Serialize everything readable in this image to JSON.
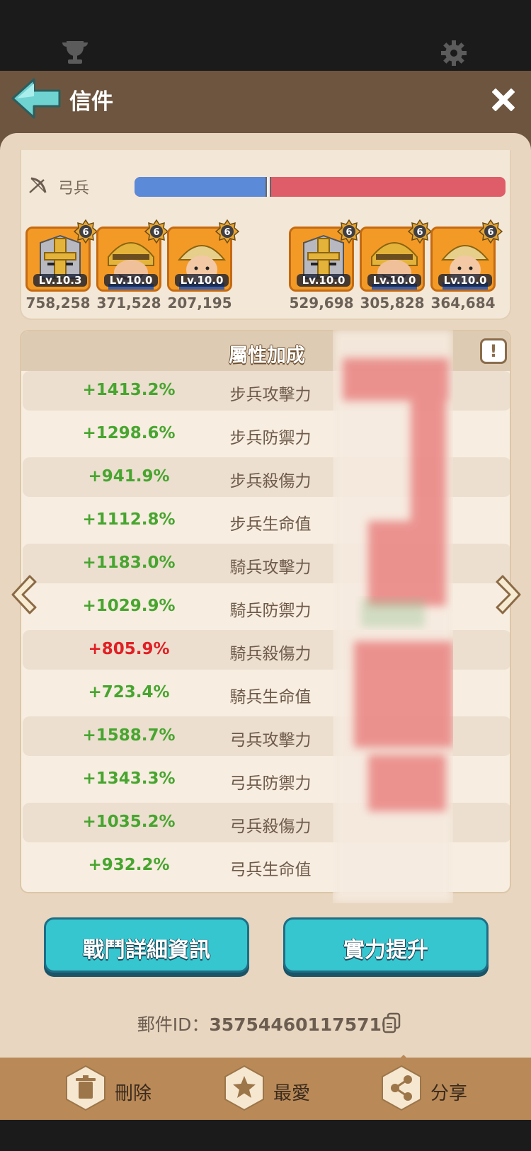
{
  "header": {
    "title": "信件"
  },
  "battle": {
    "troop_label": "弓兵",
    "balance_blue_fraction": 0.36,
    "left_heroes": [
      {
        "level": "Lv.10.3",
        "power": "758,258",
        "stars": "6"
      },
      {
        "level": "Lv.10.0",
        "power": "371,528",
        "stars": "6"
      },
      {
        "level": "Lv.10.0",
        "power": "207,195",
        "stars": "6"
      }
    ],
    "right_heroes": [
      {
        "level": "Lv.10.0",
        "power": "529,698",
        "stars": "6"
      },
      {
        "level": "Lv.10.0",
        "power": "305,828",
        "stars": "6"
      },
      {
        "level": "Lv.10.0",
        "power": "364,684",
        "stars": "6"
      }
    ]
  },
  "stats": {
    "title": "屬性加成",
    "info_label": "!",
    "rows": [
      {
        "value": "+1413.2%",
        "name": "步兵攻擊力"
      },
      {
        "value": "+1298.6%",
        "name": "步兵防禦力"
      },
      {
        "value": "+941.9%",
        "name": "步兵殺傷力"
      },
      {
        "value": "+1112.8%",
        "name": "步兵生命值"
      },
      {
        "value": "+1183.0%",
        "name": "騎兵攻擊力"
      },
      {
        "value": "+1029.9%",
        "name": "騎兵防禦力"
      },
      {
        "value": "+805.9%",
        "name": "騎兵殺傷力",
        "highlight": "red"
      },
      {
        "value": "+723.4%",
        "name": "騎兵生命值"
      },
      {
        "value": "+1588.7%",
        "name": "弓兵攻擊力"
      },
      {
        "value": "+1343.3%",
        "name": "弓兵防禦力"
      },
      {
        "value": "+1035.2%",
        "name": "弓兵殺傷力"
      },
      {
        "value": "+932.2%",
        "name": "弓兵生命值"
      }
    ]
  },
  "buttons": {
    "details": "戰鬥詳細資訊",
    "upgrade": "實力提升"
  },
  "mail": {
    "label": "郵件ID：",
    "id": "357544601175710"
  },
  "bottom": {
    "delete": "刪除",
    "favorite": "最愛",
    "share": "分享"
  },
  "colors": {
    "positive": "#47a52f",
    "negative": "#e11f24",
    "accent": "#36c6cf"
  }
}
